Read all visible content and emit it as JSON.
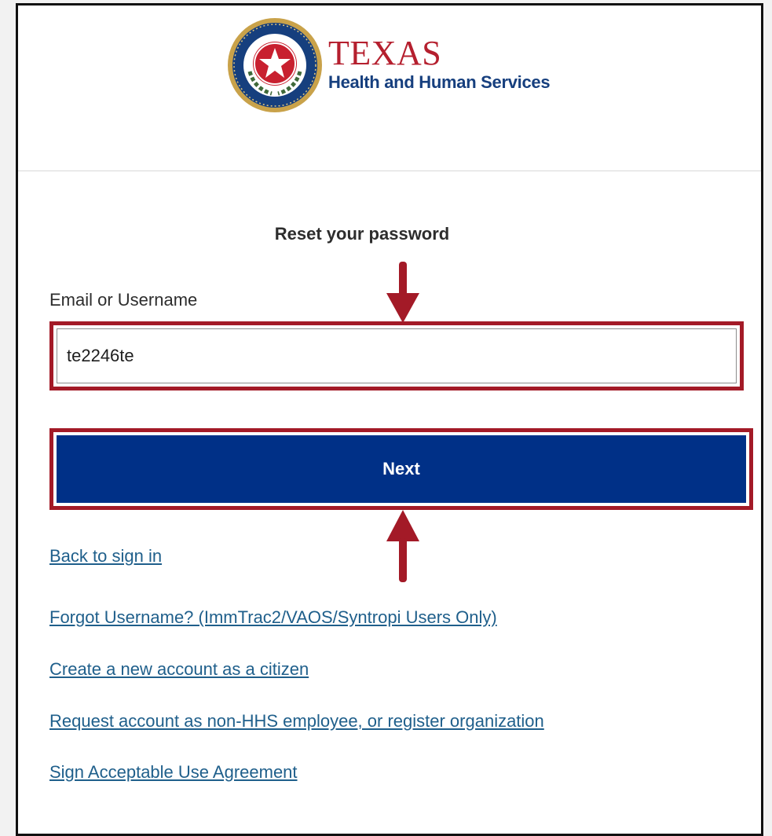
{
  "header": {
    "brand_title": "TEXAS",
    "brand_subtitle": "Health and Human Services",
    "seal_icon": "texas-seal-icon"
  },
  "form": {
    "title": "Reset your password",
    "username_label": "Email or Username",
    "username_value": "te2246te",
    "next_label": "Next"
  },
  "links": {
    "back_to_sign_in": "Back to sign in",
    "forgot_username": "Forgot Username? (ImmTrac2/VAOS/Syntropi Users Only)",
    "create_account": "Create a new account as a citizen",
    "request_account": "Request account as non-HHS employee, or register organization",
    "sign_agreement": "Sign Acceptable Use Agreement"
  },
  "annotations": {
    "highlight_color": "#a31a27",
    "arrow_icon": "arrow-icon"
  },
  "colors": {
    "brand_red": "#b51f2e",
    "brand_blue": "#163f7e",
    "button_blue": "#003087",
    "link_color": "#1f5f8b"
  }
}
